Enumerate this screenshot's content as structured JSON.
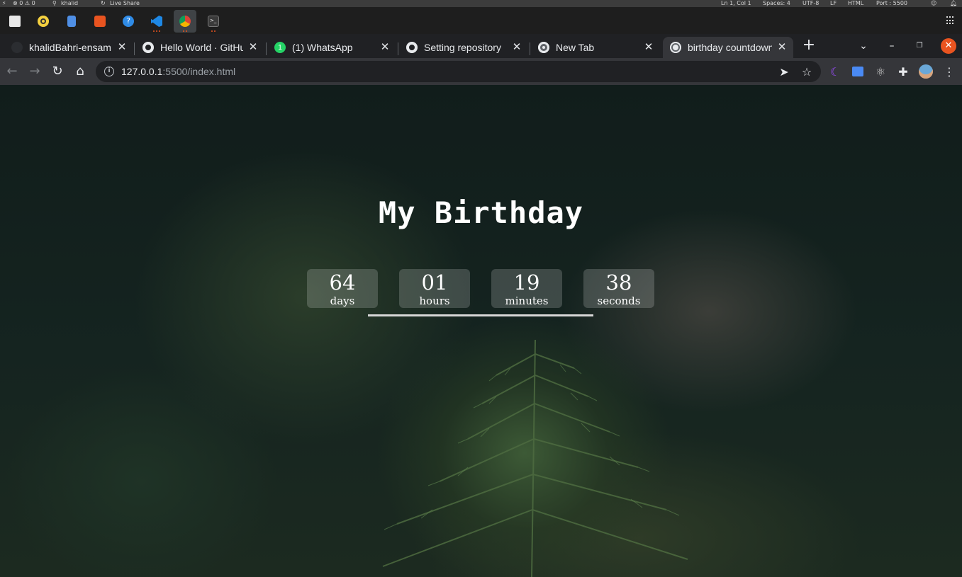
{
  "vscode_status": {
    "problems": "⊗ 0 ⚠ 0",
    "user": "khalid",
    "live_share": "Live Share",
    "cursor": "Ln 1, Col 1",
    "spaces": "Spaces: 4",
    "encoding": "UTF-8",
    "eol": "LF",
    "language": "HTML",
    "port": "Port : 5500"
  },
  "taskbar": {
    "apps": [
      {
        "name": "files",
        "color": "#e8e8e8"
      },
      {
        "name": "rhythmbox",
        "color": "#f4d03f"
      },
      {
        "name": "text-editor",
        "color": "#4f8fe5"
      },
      {
        "name": "software",
        "color": "#e95420"
      },
      {
        "name": "help",
        "color": "#2f8be6"
      },
      {
        "name": "vscode",
        "color": "#1e88e5"
      },
      {
        "name": "chrome",
        "color": "#e0a030"
      },
      {
        "name": "terminal",
        "color": "#3a3a3a"
      }
    ]
  },
  "tabs": [
    {
      "title": "khalidBahri-ensam",
      "icon": "github-icon"
    },
    {
      "title": "Hello World · GitHub",
      "icon": "github-icon"
    },
    {
      "title": "(1) WhatsApp",
      "icon": "whatsapp-icon",
      "badge": "1"
    },
    {
      "title": "Setting repository",
      "icon": "github-icon"
    },
    {
      "title": "New Tab",
      "icon": "chrome-icon"
    },
    {
      "title": "birthday countdown",
      "icon": "globe-icon",
      "active": true
    }
  ],
  "address_bar": {
    "host": "127.0.0.1",
    "path": ":5500/index.html"
  },
  "page": {
    "heading": "My Birthday",
    "countdown": [
      {
        "value": "64",
        "label": "days"
      },
      {
        "value": "01",
        "label": "hours"
      },
      {
        "value": "19",
        "label": "minutes"
      },
      {
        "value": "38",
        "label": "seconds"
      }
    ]
  },
  "colors": {
    "accent_close": "#e95420",
    "text": "#ffffff",
    "tab_active": "#35363a"
  }
}
